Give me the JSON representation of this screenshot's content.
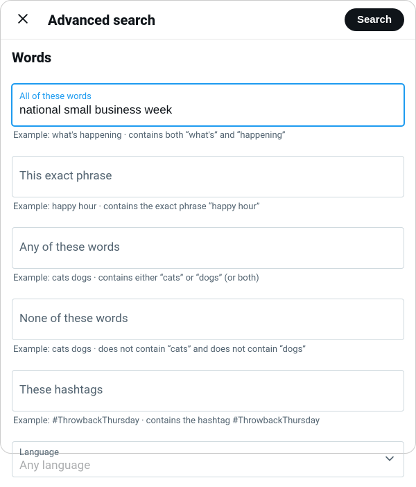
{
  "header": {
    "title": "Advanced search",
    "search_button": "Search"
  },
  "section_title": "Words",
  "fields": {
    "all_words": {
      "label": "All of these words",
      "value": "national small business week",
      "example": "Example: what's happening · contains both “what's” and “happening”"
    },
    "exact_phrase": {
      "label": "This exact phrase",
      "example": "Example: happy hour · contains the exact phrase “happy hour”"
    },
    "any_words": {
      "label": "Any of these words",
      "example": "Example: cats dogs · contains either “cats” or “dogs” (or both)"
    },
    "none_words": {
      "label": "None of these words",
      "example": "Example: cats dogs · does not contain “cats” and does not contain “dogs”"
    },
    "hashtags": {
      "label": "These hashtags",
      "example": "Example: #ThrowbackThursday · contains the hashtag #ThrowbackThursday"
    }
  },
  "language": {
    "label": "Language",
    "value": "Any language"
  }
}
